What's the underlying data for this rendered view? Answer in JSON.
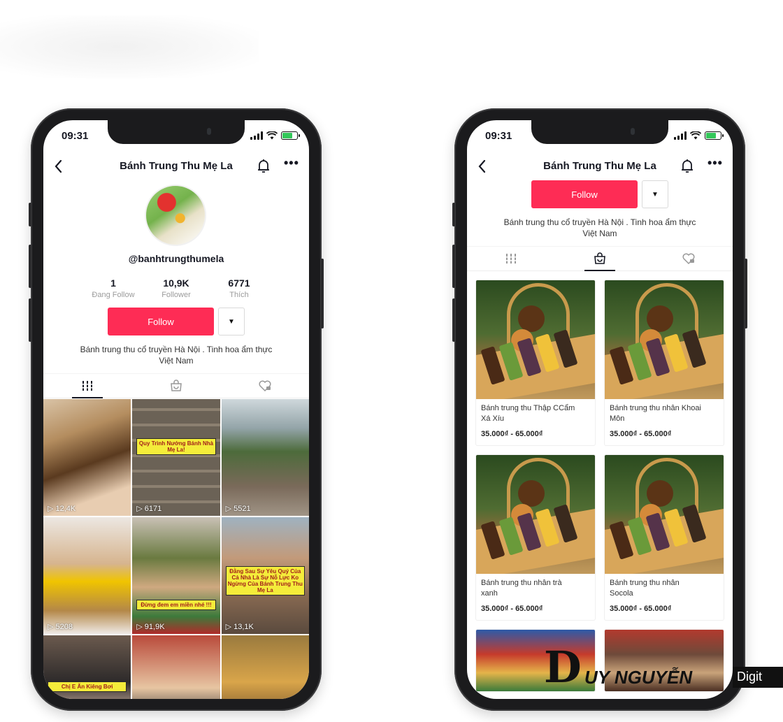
{
  "status": {
    "time": "09:31"
  },
  "profile": {
    "name": "Bánh Trung Thu Mẹ La",
    "handle": "@banhtrungthumela",
    "stats": [
      {
        "value": "1",
        "label": "Đang Follow"
      },
      {
        "value": "10,9K",
        "label": "Follower"
      },
      {
        "value": "6771",
        "label": "Thích"
      }
    ],
    "follow_label": "Follow",
    "bio_line1": "Bánh trung thu cổ truyền Hà Nội . Tinh hoa ẩm thực",
    "bio_line2": "Việt Nam"
  },
  "tabs": [
    "videos-grid",
    "shop-bag",
    "liked-heart"
  ],
  "videos": [
    {
      "views": "12,4K",
      "caption": ""
    },
    {
      "views": "6171",
      "caption": "Quy Trình Nướng Bánh Nhà Mẹ La!"
    },
    {
      "views": "5521",
      "caption": ""
    },
    {
      "views": "5208",
      "caption": ""
    },
    {
      "views": "91,9K",
      "caption": "Đừng đem em miền nhé !!!"
    },
    {
      "views": "13,1K",
      "caption": "Đằng Sau Sự Yêu Quý Của Cả Nhà Là Sự Nỗ Lực Ko Ngừng Của Bánh Trung Thu Mẹ La"
    },
    {
      "views": "",
      "caption": "Chị E Ăn Kiêng Bơi"
    },
    {
      "views": "",
      "caption": ""
    },
    {
      "views": "",
      "caption": ""
    }
  ],
  "products": [
    {
      "name_line1": "Bánh trung thu Thập CCẩm",
      "name_line2": "Xá Xíu",
      "price": "35.000₫ - 65.000₫"
    },
    {
      "name_line1": "Bánh trung thu nhân Khoai",
      "name_line2": "Môn",
      "price": "35.000₫ - 65.000₫"
    },
    {
      "name_line1": "Bánh trung thu nhân trà",
      "name_line2": "xanh",
      "price": "35.000₫ - 65.000₫"
    },
    {
      "name_line1": "Bánh trung thu nhân",
      "name_line2": "Socola",
      "price": "35.000₫ - 65.000₫"
    }
  ],
  "watermark": {
    "letter": "D",
    "name": "UY NGUYỄN",
    "suffix": "Digit"
  },
  "colors": {
    "accent": "#fe2c55",
    "text": "#161823",
    "muted": "#9b9b9b"
  }
}
